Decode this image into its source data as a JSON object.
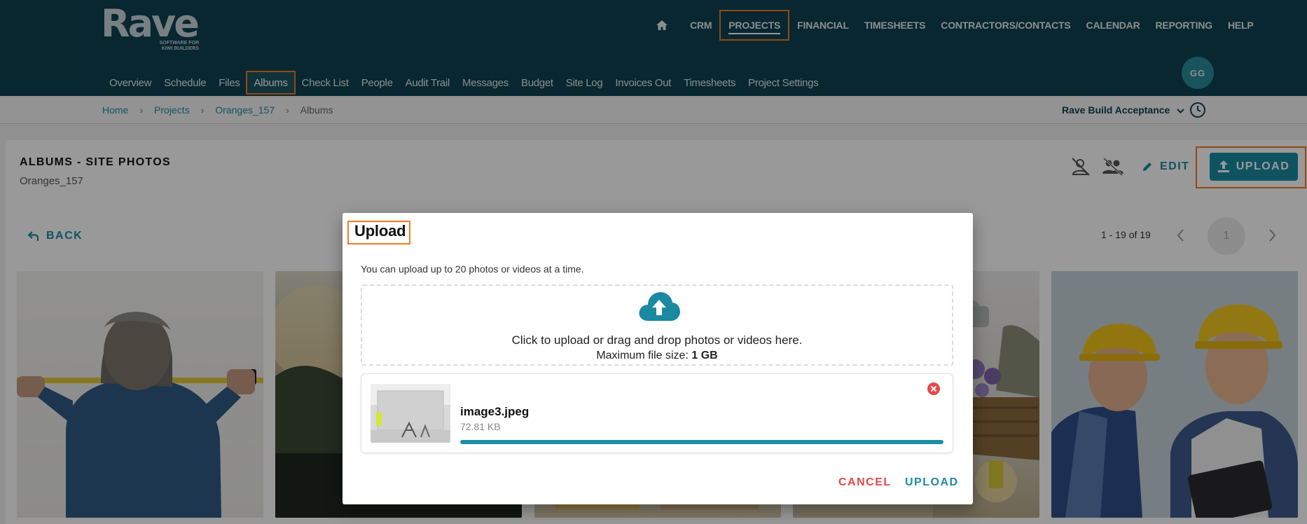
{
  "brand": {
    "logo_word": "Rave",
    "logo_tagline_line1": "SOFTWARE FOR",
    "logo_tagline_line2": "KIWI BUILDERS"
  },
  "top_nav": {
    "items": [
      {
        "label": "CRM"
      },
      {
        "label": "PROJECTS",
        "active": true
      },
      {
        "label": "FINANCIAL"
      },
      {
        "label": "TIMESHEETS"
      },
      {
        "label": "CONTRACTORS/CONTACTS"
      },
      {
        "label": "CALENDAR"
      },
      {
        "label": "REPORTING"
      },
      {
        "label": "HELP"
      }
    ],
    "home_icon": "home-icon"
  },
  "user": {
    "initials": "GG"
  },
  "sub_nav": {
    "items": [
      {
        "label": "Overview"
      },
      {
        "label": "Schedule"
      },
      {
        "label": "Files"
      },
      {
        "label": "Albums",
        "active": true
      },
      {
        "label": "Check List"
      },
      {
        "label": "People"
      },
      {
        "label": "Audit Trail"
      },
      {
        "label": "Messages"
      },
      {
        "label": "Budget"
      },
      {
        "label": "Site Log"
      },
      {
        "label": "Invoices Out"
      },
      {
        "label": "Timesheets"
      },
      {
        "label": "Project Settings"
      }
    ]
  },
  "breadcrumb": {
    "items": [
      "Home",
      "Projects",
      "Oranges_157"
    ],
    "current": "Albums"
  },
  "company_selector": {
    "value": "Rave Build Acceptance"
  },
  "album": {
    "title": "ALBUMS - SITE PHOTOS",
    "project": "Oranges_157",
    "edit_label": "EDIT",
    "upload_label": "UPLOAD",
    "back_label": "BACK"
  },
  "pagination": {
    "range": "1 - 19 of 19",
    "current_page": "1"
  },
  "dialog": {
    "title": "Upload",
    "hint": "You can upload up to 20 photos or videos at a time.",
    "drop_line1": "Click to upload or drag and drop photos or videos here.",
    "drop_line2_prefix": "Maximum file size:",
    "max_size": "1 GB",
    "file": {
      "name": "image3.jpeg",
      "size": "72.81 KB",
      "progress_percent": 100
    },
    "cancel_label": "CANCEL",
    "upload_label": "UPLOAD"
  },
  "colors": {
    "header_bg": "#0e4250",
    "accent": "#1b8aa0",
    "highlight_frame": "#f47a20",
    "danger": "#e4484b"
  }
}
